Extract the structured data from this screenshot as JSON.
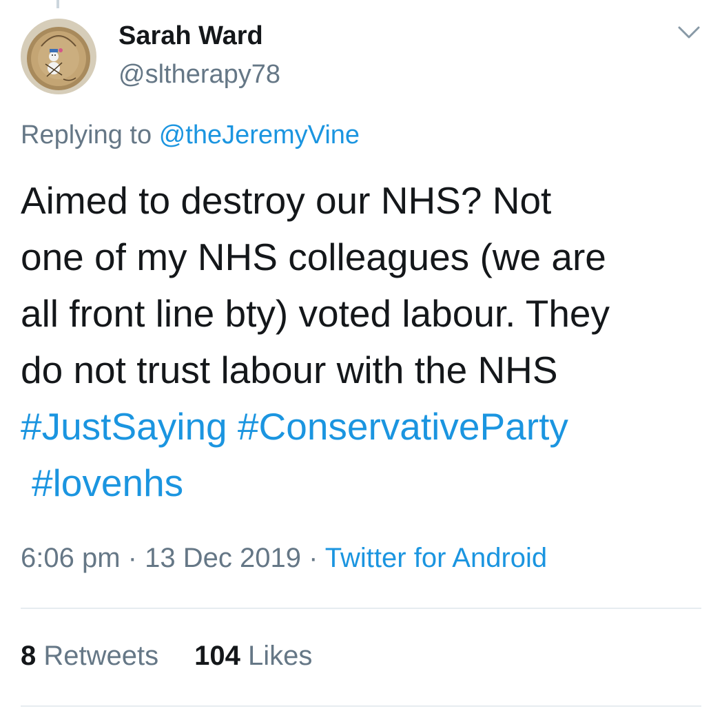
{
  "author": {
    "name": "Sarah Ward",
    "handle": "@sltherapy78",
    "avatar_icon": "wooden-ornament-avatar"
  },
  "reply": {
    "prefix": "Replying to",
    "mention": "@theJeremyVine"
  },
  "tweet": {
    "line1": "Aimed to destroy our NHS? Not",
    "line2": "one of my NHS colleagues (we are",
    "line3": "all front line bty) voted labour. They",
    "line4": "do not trust labour with the NHS",
    "hashtags": [
      "#JustSaying",
      "#ConservativeParty",
      "#lovenhs"
    ]
  },
  "meta": {
    "time": "6:06 pm",
    "separator": "·",
    "date": "13 Dec 2019",
    "source": "Twitter for Android"
  },
  "stats": {
    "retweets_count": "8",
    "retweets_label": "Retweets",
    "likes_count": "104",
    "likes_label": "Likes"
  },
  "colors": {
    "link": "#1b95e0",
    "secondary_text": "#657786",
    "primary_text": "#14171a",
    "divider": "#e6ecf0"
  }
}
